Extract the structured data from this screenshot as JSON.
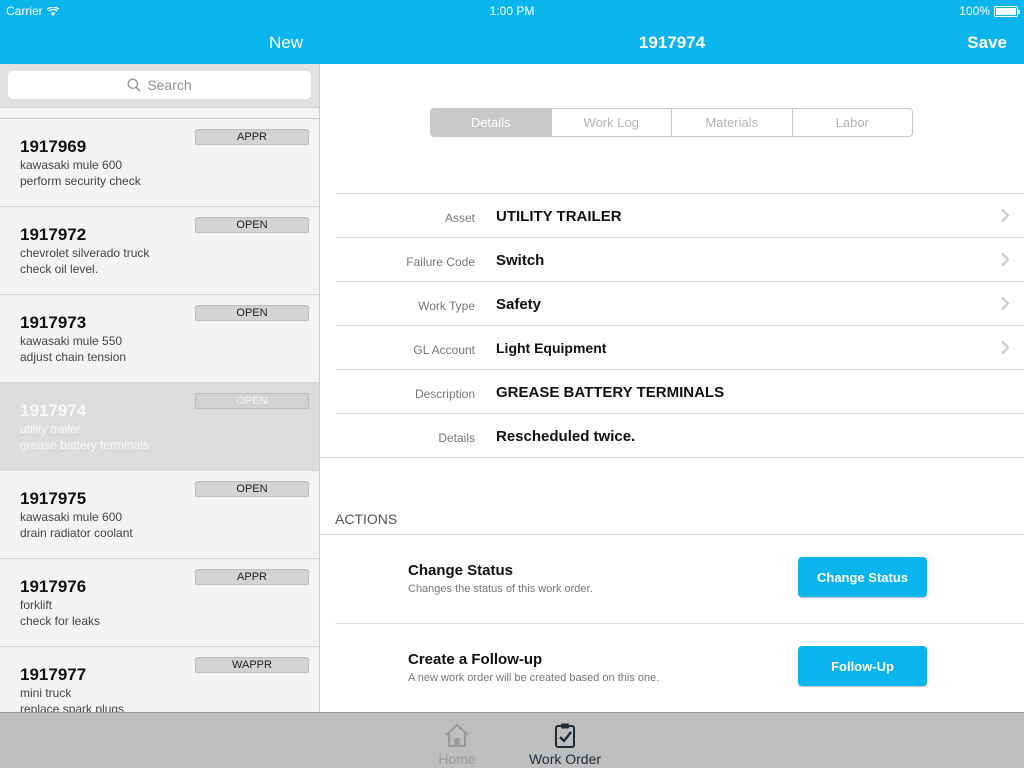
{
  "status_bar": {
    "carrier": "Carrier",
    "time": "1:00 PM",
    "battery": "100%"
  },
  "nav": {
    "new_label": "New",
    "title": "1917974",
    "save_label": "Save"
  },
  "search": {
    "placeholder": "Search"
  },
  "work_orders": [
    {
      "number": "1917969",
      "asset": "kawasaki mule 600",
      "task": "perform security check",
      "status": "APPR"
    },
    {
      "number": "1917972",
      "asset": "chevrolet silverado truck",
      "task": "check oil level.",
      "status": "OPEN"
    },
    {
      "number": "1917973",
      "asset": "kawasaki mule 550",
      "task": "adjust chain tension",
      "status": "OPEN"
    },
    {
      "number": "1917974",
      "asset": "utility trailer",
      "task": "grease battery terminals",
      "status": "OPEN"
    },
    {
      "number": "1917975",
      "asset": "kawasaki mule 600",
      "task": "drain radiator coolant",
      "status": "OPEN"
    },
    {
      "number": "1917976",
      "asset": "forklift",
      "task": "check for leaks",
      "status": "APPR"
    },
    {
      "number": "1917977",
      "asset": "mini truck",
      "task": "replace spark plugs",
      "status": "WAPPR"
    }
  ],
  "selected_index": 3,
  "tabs": [
    "Details",
    "Work Log",
    "Materials",
    "Labor"
  ],
  "active_tab": "Details",
  "fields": [
    {
      "label": "Asset",
      "value": "UTILITY TRAILER"
    },
    {
      "label": "Failure Code",
      "value": "Switch"
    },
    {
      "label": "Work Type",
      "value": "Safety"
    },
    {
      "label": "GL Account",
      "value": "Light Equipment"
    },
    {
      "label": "Description",
      "value": "GREASE BATTERY TERMINALS"
    },
    {
      "label": "Details",
      "value": "Rescheduled twice."
    }
  ],
  "actions": {
    "header": "ACTIONS",
    "items": [
      {
        "title": "Change Status",
        "subtitle": "Changes the status of this work order.",
        "button": "Change Status"
      },
      {
        "title": "Create a Follow-up",
        "subtitle": "A new work order will be created based on this one.",
        "button": "Follow-Up"
      }
    ]
  },
  "tabbar": {
    "home_label": "Home",
    "workorder_label": "Work Order"
  },
  "colors": {
    "accent": "#0ab4ec",
    "selected_row": "#dcdcdc",
    "tabbar_active": "#1e2b38"
  },
  "icons": {
    "search": "magnifier-icon",
    "chevron": "chevron-right-icon",
    "home": "home-icon",
    "work_order": "clipboard-check-icon"
  }
}
